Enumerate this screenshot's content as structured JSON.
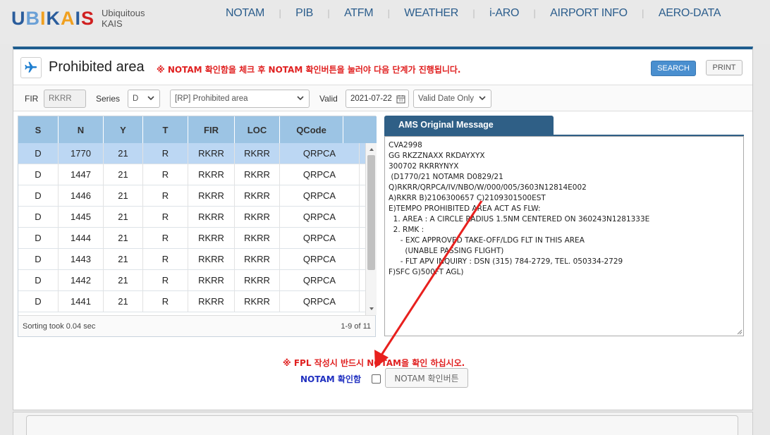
{
  "logo": {
    "text": "UBIKAIS",
    "sub_line1": "Ubiquitous",
    "sub_line2": "KAIS"
  },
  "nav": [
    "NOTAM",
    "PIB",
    "ATFM",
    "WEATHER",
    "i-ARO",
    "AIRPORT INFO",
    "AERO-DATA"
  ],
  "page": {
    "title": "Prohibited area",
    "warning": "※ NOTAM 확인함을 체크 후 NOTAM 확인버튼을 눌러야 다음 단계가 진행됩니다.",
    "search_label": "SEARCH",
    "print_label": "PRINT"
  },
  "filters": {
    "fir_label": "FIR",
    "fir_value": "RKRR",
    "series_label": "Series",
    "series_value": "D",
    "area_value": "[RP] Prohibited area",
    "valid_label": "Valid",
    "valid_date": "2021-07-22",
    "valid_mode": "Valid Date Only"
  },
  "table": {
    "columns": [
      "S",
      "N",
      "Y",
      "T",
      "FIR",
      "LOC",
      "QCode"
    ],
    "rows": [
      [
        "D",
        "1770",
        "21",
        "R",
        "RKRR",
        "RKRR",
        "QRPCA"
      ],
      [
        "D",
        "1447",
        "21",
        "R",
        "RKRR",
        "RKRR",
        "QRPCA"
      ],
      [
        "D",
        "1446",
        "21",
        "R",
        "RKRR",
        "RKRR",
        "QRPCA"
      ],
      [
        "D",
        "1445",
        "21",
        "R",
        "RKRR",
        "RKRR",
        "QRPCA"
      ],
      [
        "D",
        "1444",
        "21",
        "R",
        "RKRR",
        "RKRR",
        "QRPCA"
      ],
      [
        "D",
        "1443",
        "21",
        "R",
        "RKRR",
        "RKRR",
        "QRPCA"
      ],
      [
        "D",
        "1442",
        "21",
        "R",
        "RKRR",
        "RKRR",
        "QRPCA"
      ],
      [
        "D",
        "1441",
        "21",
        "R",
        "RKRR",
        "RKRR",
        "QRPCA"
      ]
    ],
    "selected_row": 0,
    "sort_message": "Sorting took 0.04 sec",
    "page_info": "1-9 of 11"
  },
  "ams": {
    "tab_label": "AMS Original Message",
    "message": "CVA2998\nGG RKZZNAXX RKDAYXYX\n300702 RKRRYNYX\n (D1770/21 NOTAMR D0829/21\nQ)RKRR/QRPCA/IV/NBO/W/000/005/3603N12814E002\nA)RKRR B)2106300657 C)2109301500EST\nE)TEMPO PROHIBITED AREA ACT AS FLW:\n  1. AREA : A CIRCLE RADIUS 1.5NM CENTERED ON 360243N1281333E\n  2. RMK :\n     - EXC APPROVED TAKE-OFF/LDG FLT IN THIS AREA\n       (UNABLE PASSING FLIGHT)\n     - FLT APV INQUIRY : DSN (315) 784-2729, TEL. 050334-2729\nF)SFC G)500FT AGL)"
  },
  "confirm": {
    "warning": "※ FPL 작성시 반드시 NOTAM을 확인 하십시오.",
    "checkbox_label": "NOTAM 확인함",
    "button_label": "NOTAM 확인버튼"
  },
  "colors": {
    "accent": "#1f5d8e",
    "header": "#9cc4e4",
    "warning": "#e02020",
    "annotation_arrow": "#e8201e"
  }
}
